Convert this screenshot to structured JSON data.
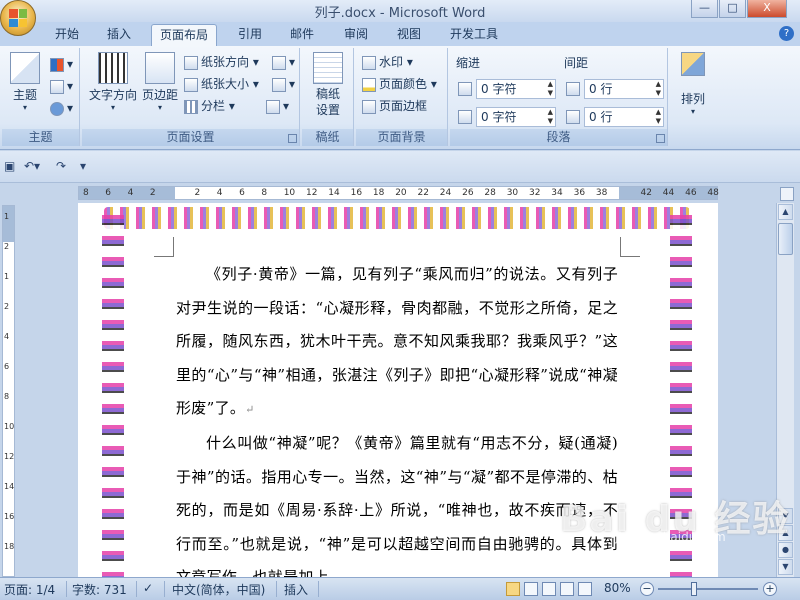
{
  "window": {
    "title": "列子.docx - Microsoft Word",
    "controls": {
      "minimize": "—",
      "maximize": "□",
      "close": "X"
    }
  },
  "tabs": [
    "开始",
    "插入",
    "页面布局",
    "引用",
    "邮件",
    "审阅",
    "视图",
    "开发工具"
  ],
  "active_tab": "页面布局",
  "ribbon": {
    "themes": {
      "label": "主题",
      "theme_btn": "主题"
    },
    "page_setup": {
      "label": "页面设置",
      "text_direction": "文字方向",
      "margins": "页边距",
      "orientation": "纸张方向",
      "size": "纸张大小",
      "columns": "分栏"
    },
    "draft": {
      "label": "稿纸",
      "btn": "稿纸设置"
    },
    "page_background": {
      "label": "页面背景",
      "watermark": "水印",
      "page_color": "页面颜色",
      "page_borders": "页面边框"
    },
    "paragraph": {
      "label": "段落",
      "indent_label": "缩进",
      "spacing_label": "间距",
      "indent_left": "0 字符",
      "indent_right": "0 字符",
      "spacing_before": "0 行",
      "spacing_after": "0 行"
    },
    "arrange": {
      "label": "排列",
      "btn": "排列"
    }
  },
  "ruler": {
    "numbers": [
      "8",
      "6",
      "4",
      "2",
      "",
      "2",
      "4",
      "6",
      "8",
      "10",
      "12",
      "14",
      "16",
      "18",
      "20",
      "22",
      "24",
      "26",
      "28",
      "30",
      "32",
      "34",
      "36",
      "38",
      "",
      "42",
      "44",
      "46",
      "48"
    ],
    "vnumbers": [
      "1",
      "2",
      "1",
      "2",
      "4",
      "6",
      "8",
      "10",
      "12",
      "14",
      "16",
      "18"
    ]
  },
  "document": {
    "paragraphs": [
      "《列子·黄帝》一篇，见有列子“乘风而归”的说法。又有列子对尹生说的一段话：“心凝形释，骨肉都融，不觉形之所倚，足之所履，随风东西，犹木叶干壳。意不知风乘我耶？我乘风乎？”这里的“心”与“神”相通，张湛注《列子》即把“心凝形释”说成“神凝形废”了。",
      "什么叫做“神凝”呢？《黄帝》篇里就有“用志不分，疑(通凝)于神”的话。指用心专一。当然，这“神”与“凝”都不是停滞的、枯死的，而是如《周易·系辞·上》所说，“唯神也，故不疾而速，不行而至。”也就是说，“神”是可以超越空间而自由驰骋的。具体到文章写作，也就是加上"
    ],
    "para_mark": "↵"
  },
  "status": {
    "page": "页面: 1/4",
    "words": "字数: 731",
    "language": "中文(简体，中国)",
    "mode": "插入",
    "zoom": "80%",
    "zoom_fraction": 0.36
  },
  "watermark": {
    "text": "Bai du 经验",
    "url": "jingyan.baidu.com"
  }
}
